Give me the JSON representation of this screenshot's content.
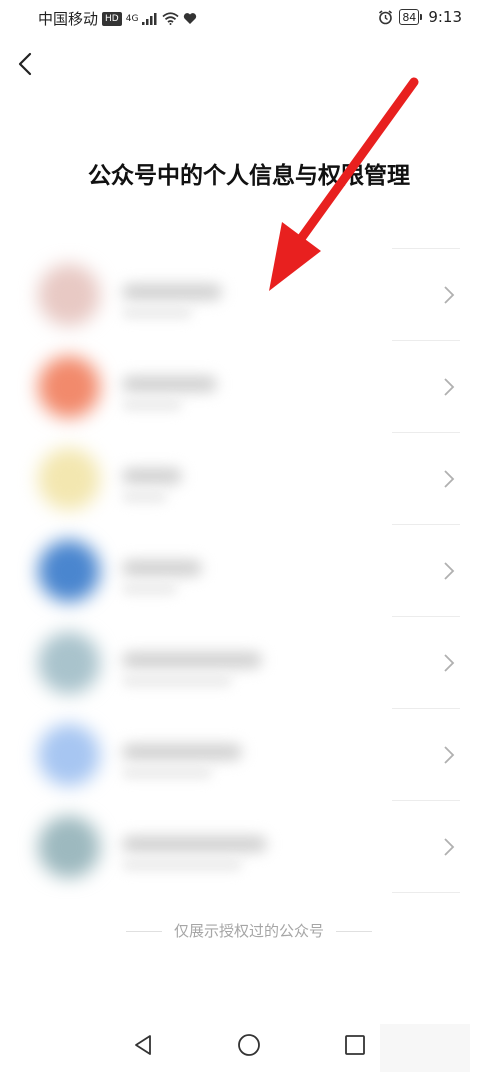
{
  "status_bar": {
    "carrier": "中国移动",
    "hd": "HD",
    "network": "4G",
    "battery": "84",
    "time": "9:13"
  },
  "header": {
    "back_icon": "chevron-left-icon"
  },
  "page": {
    "title": "公众号中的个人信息与权限管理",
    "footer_note": "仅展示授权过的公众号"
  },
  "accounts": [
    {
      "avatar_color": "#e8c9c4"
    },
    {
      "avatar_color": "#f28a6c"
    },
    {
      "avatar_color": "#f3e7b0"
    },
    {
      "avatar_color": "#4a86cf"
    },
    {
      "avatar_color": "#a9c3cc"
    },
    {
      "avatar_color": "#a7c6f2"
    },
    {
      "avatar_color": "#9db9bf"
    }
  ],
  "annotation": {
    "arrow_color": "#e8201f"
  },
  "nav_bar": {
    "icons": [
      "back-triangle-icon",
      "home-circle-icon",
      "recents-square-icon"
    ]
  }
}
